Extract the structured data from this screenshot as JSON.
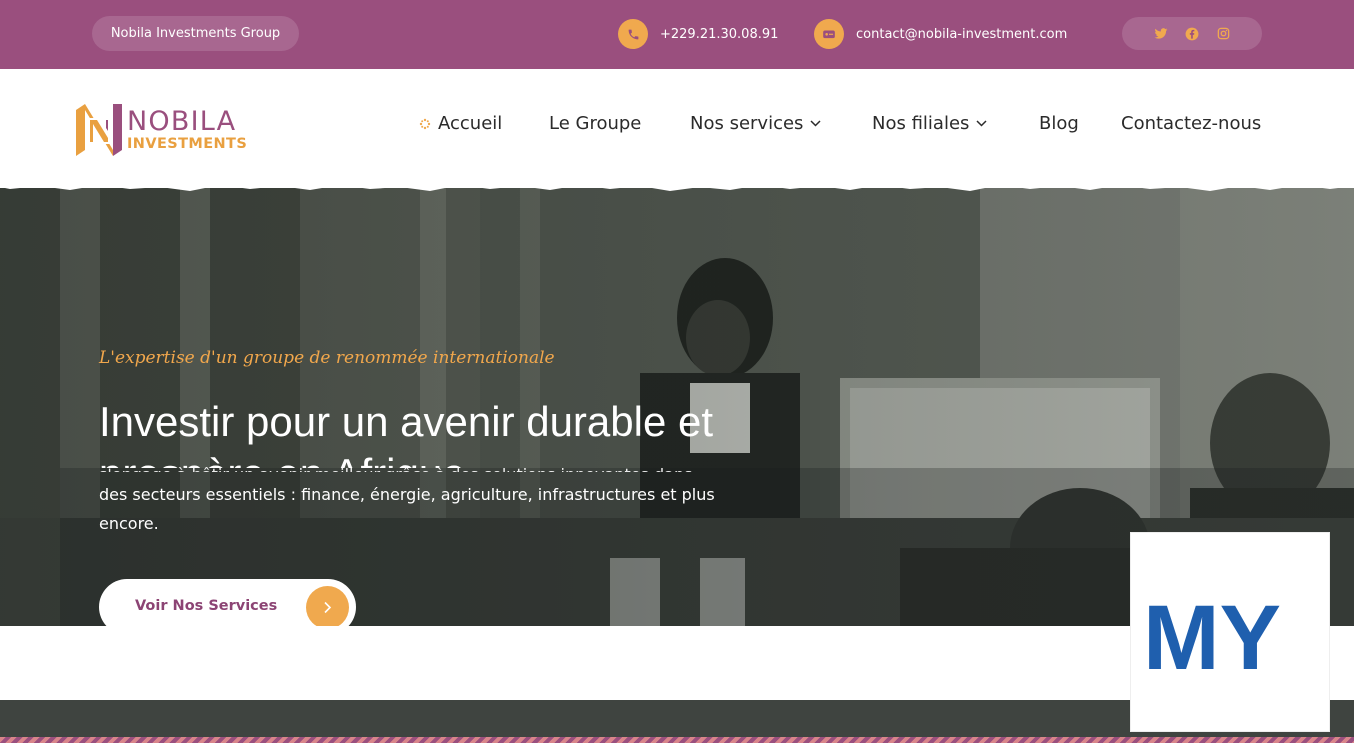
{
  "topbar": {
    "brand_label": "Nobila Investments Group",
    "phone": "+229.21.30.08.91",
    "email": "contact@nobila-investment.com",
    "phone_icon": "phone-icon",
    "email_icon": "mail-icon",
    "social_icons": [
      "twitter-icon",
      "facebook-icon",
      "instagram-icon"
    ]
  },
  "header": {
    "logo_name": "NOBILA",
    "logo_sub": "INVESTMENTS",
    "nav": {
      "home": "Accueil",
      "group": "Le Groupe",
      "services": "Nos services",
      "subsidiaries": "Nos filiales",
      "blog": "Blog",
      "contact": "Contactez-nous"
    }
  },
  "hero": {
    "tagline": "L'expertise d'un groupe de renommée internationale",
    "title_line1": "Investir pour un avenir durable et",
    "title_line2": "prospère en Afrique",
    "desc_line1": "s'engage à bâtir un avenir meilleur grâce à des solutions innovantes dans",
    "description": "des secteurs essentiels : finance, énergie, agriculture, infrastructures et plus encore.",
    "cta_label": "Voir Nos Services"
  },
  "ad": {
    "text": "MY"
  },
  "colors": {
    "brand_purple": "#9a4f7e",
    "accent_orange": "#f0a94e",
    "nav_text": "#2b2b2b"
  }
}
